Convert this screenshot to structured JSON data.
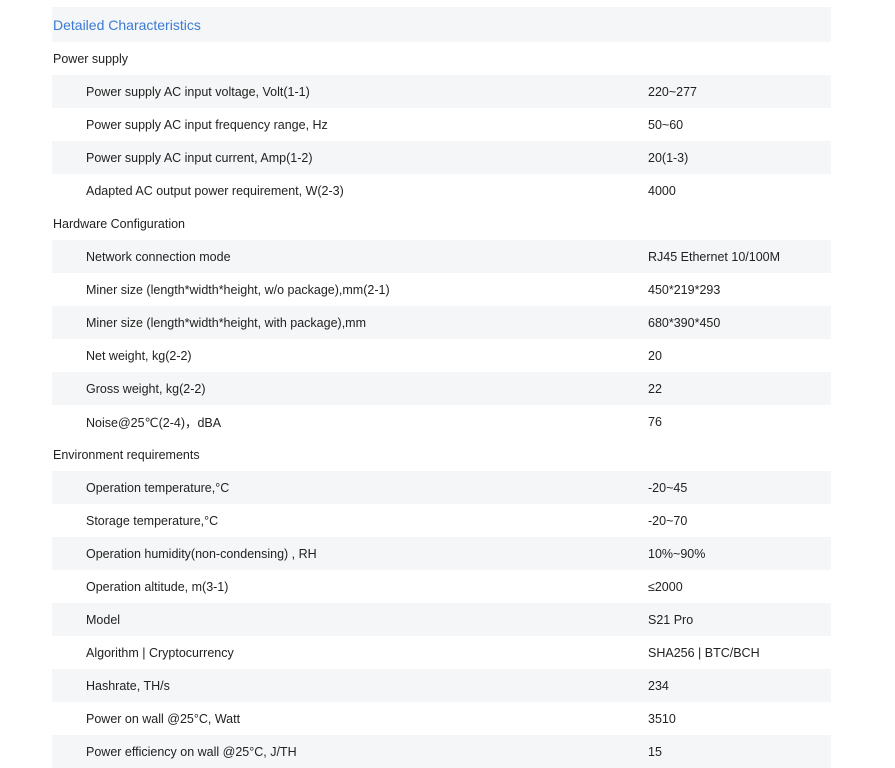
{
  "title": "Detailed Characteristics",
  "sections": [
    {
      "heading": "Power supply",
      "rows": [
        {
          "label": "Power supply AC input voltage, Volt(1-1)",
          "value": "220~277"
        },
        {
          "label": "Power supply AC input frequency range, Hz",
          "value": "50~60"
        },
        {
          "label": "Power supply AC input current, Amp(1-2)",
          "value": "20(1-3)"
        },
        {
          "label": "Adapted AC output power requirement, W(2-3)",
          "value": "4000"
        }
      ]
    },
    {
      "heading": "Hardware Configuration",
      "rows": [
        {
          "label": "Network connection mode",
          "value": "RJ45 Ethernet 10/100M"
        },
        {
          "label": "Miner size (length*width*height, w/o package),mm(2-1)",
          "value": "450*219*293"
        },
        {
          "label": "Miner size (length*width*height, with package),mm",
          "value": "680*390*450"
        },
        {
          "label": "Net weight, kg(2-2)",
          "value": "20"
        },
        {
          "label": "Gross weight, kg(2-2)",
          "value": "22"
        },
        {
          "label": "Noise@25℃(2-4)，dBA",
          "value": "76"
        }
      ]
    },
    {
      "heading": "Environment requirements",
      "rows": [
        {
          "label": "Operation temperature,°C",
          "value": "-20~45"
        },
        {
          "label": "Storage temperature,°C",
          "value": "-20~70"
        },
        {
          "label": "Operation humidity(non-condensing) , RH",
          "value": "10%~90%"
        },
        {
          "label": "Operation altitude, m(3-1)",
          "value": "≤2000"
        },
        {
          "label": "Model",
          "value": "S21 Pro"
        },
        {
          "label": "Algorithm | Cryptocurrency",
          "value": "SHA256 | BTC/BCH"
        },
        {
          "label": "Hashrate, TH/s",
          "value": "234"
        },
        {
          "label": "Power on wall @25°C, Watt",
          "value": "3510"
        },
        {
          "label": "Power efficiency on wall @25°C, J/TH",
          "value": "15"
        }
      ]
    }
  ]
}
